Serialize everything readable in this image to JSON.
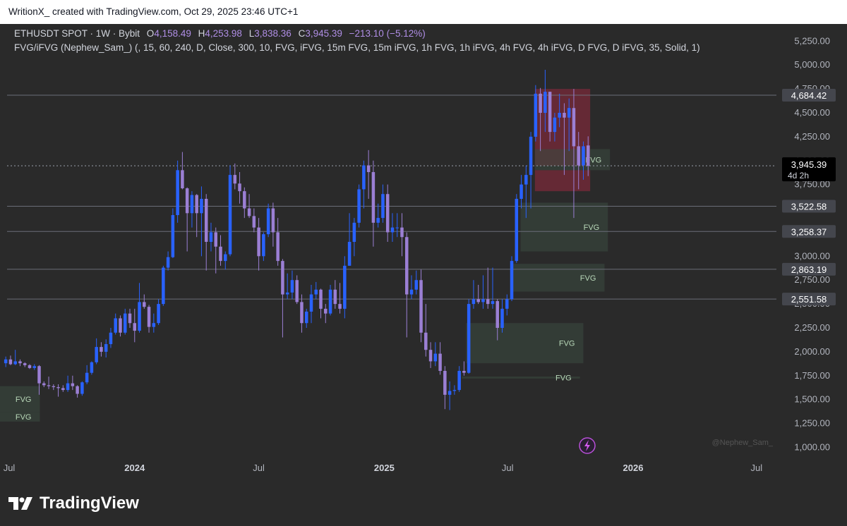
{
  "header": {
    "attribution": "WritionX_ created with TradingView.com, Oct 29, 2025 23:46 UTC+1"
  },
  "legend": {
    "symbol": "ETHUSDT SPOT · 1W · Bybit",
    "o_label": "O",
    "o_value": "4,158.49",
    "h_label": "H",
    "h_value": "4,253.98",
    "l_label": "L",
    "l_value": "3,838.36",
    "c_label": "C",
    "c_value": "3,945.39",
    "change": "−213.10 (−5.12%)",
    "indicator": "FVG/iFVG (Nephew_Sam_) (, 15, 60, 240, D, Close, 300, 10, FVG, iFVG, 15m FVG, 15m iFVG, 1h FVG, 1h iFVG, 4h FVG, 4h iFVG, D FVG, D iFVG, 35, Solid, 1)"
  },
  "footer": {
    "brand": "TradingView",
    "watermark": "@Nephew_Sam_"
  },
  "colors": {
    "up": "#2962ff",
    "down": "#9b7fd4",
    "fvg": "#3a4a3f",
    "ifvg": "#7a2a3a",
    "background": "#2a2a2a"
  },
  "chart_data": {
    "type": "candlestick",
    "symbol": "ETHUSDT",
    "timeframe": "1W",
    "ylim": [
      900,
      5400
    ],
    "y_ticks": [
      "5,250.00",
      "5,000.00",
      "4,750.00",
      "4,500.00",
      "4,250.00",
      "4,000.00",
      "3,750.00",
      "3,500.00",
      "3,250.00",
      "3,000.00",
      "2,750.00",
      "2,500.00",
      "2,250.00",
      "2,000.00",
      "1,750.00",
      "1,500.00",
      "1,250.00",
      "1,000.00"
    ],
    "x_ticks": [
      "Jul",
      "2024",
      "Jul",
      "2025",
      "Jul",
      "2026",
      "Jul"
    ],
    "price_labels": [
      {
        "value": 4684.42,
        "text": "4,684.42"
      },
      {
        "value": 3522.58,
        "text": "3,522.58"
      },
      {
        "value": 3258.37,
        "text": "3,258.37"
      },
      {
        "value": 2863.19,
        "text": "2,863.19"
      },
      {
        "value": 2551.58,
        "text": "2,551.58"
      }
    ],
    "last_price": {
      "value": 3945.39,
      "text": "3,945.39",
      "countdown": "4d 2h"
    },
    "zones": [
      {
        "kind": "iFVG",
        "label": "",
        "from": 3945,
        "to": 4750,
        "start": "2025-08-10",
        "end": "2025-10-30"
      },
      {
        "kind": "iFVG",
        "label": "",
        "from": 3680,
        "to": 3900,
        "start": "2025-08-10",
        "end": "2025-10-30"
      },
      {
        "kind": "FVG",
        "label": "FVG",
        "from": 3900,
        "to": 4120,
        "start": "2025-08-10",
        "end": "2025-11-28"
      },
      {
        "kind": "FVG",
        "label": "FVG",
        "from": 3050,
        "to": 3560,
        "start": "2025-07-20",
        "end": "2025-11-25"
      },
      {
        "kind": "FVG",
        "label": "FVG",
        "from": 2630,
        "to": 2920,
        "start": "2025-07-05",
        "end": "2025-11-20"
      },
      {
        "kind": "FVG",
        "label": "FVG",
        "from": 1880,
        "to": 2300,
        "start": "2025-05-01",
        "end": "2025-10-20"
      },
      {
        "kind": "FVG",
        "label": "FVG",
        "from": 1720,
        "to": 1740,
        "start": "2025-04-25",
        "end": "2025-10-15"
      },
      {
        "kind": "FVG",
        "label": "FVG",
        "from": 1370,
        "to": 1640,
        "start": "2023-06-10",
        "end": "2023-08-15"
      },
      {
        "kind": "FVG",
        "label": "FVG",
        "from": 1270,
        "to": 1370,
        "start": "2023-06-10",
        "end": "2023-08-15"
      }
    ],
    "candles": [
      {
        "t": "2023-06-26",
        "o": 1880,
        "h": 1950,
        "l": 1840,
        "c": 1920
      },
      {
        "t": "2023-07-03",
        "o": 1920,
        "h": 1960,
        "l": 1860,
        "c": 1870
      },
      {
        "t": "2023-07-10",
        "o": 1870,
        "h": 2020,
        "l": 1860,
        "c": 1900
      },
      {
        "t": "2023-07-17",
        "o": 1900,
        "h": 1920,
        "l": 1850,
        "c": 1880
      },
      {
        "t": "2023-07-24",
        "o": 1880,
        "h": 1890,
        "l": 1840,
        "c": 1860
      },
      {
        "t": "2023-07-31",
        "o": 1860,
        "h": 1870,
        "l": 1820,
        "c": 1830
      },
      {
        "t": "2023-08-07",
        "o": 1830,
        "h": 1870,
        "l": 1810,
        "c": 1850
      },
      {
        "t": "2023-08-14",
        "o": 1850,
        "h": 1860,
        "l": 1550,
        "c": 1670
      },
      {
        "t": "2023-08-21",
        "o": 1670,
        "h": 1690,
        "l": 1630,
        "c": 1650
      },
      {
        "t": "2023-08-28",
        "o": 1650,
        "h": 1740,
        "l": 1610,
        "c": 1640
      },
      {
        "t": "2023-09-04",
        "o": 1640,
        "h": 1660,
        "l": 1600,
        "c": 1630
      },
      {
        "t": "2023-09-11",
        "o": 1630,
        "h": 1660,
        "l": 1530,
        "c": 1620
      },
      {
        "t": "2023-09-18",
        "o": 1620,
        "h": 1650,
        "l": 1580,
        "c": 1600
      },
      {
        "t": "2023-09-25",
        "o": 1600,
        "h": 1750,
        "l": 1580,
        "c": 1670
      },
      {
        "t": "2023-10-02",
        "o": 1670,
        "h": 1750,
        "l": 1600,
        "c": 1640
      },
      {
        "t": "2023-10-09",
        "o": 1640,
        "h": 1650,
        "l": 1520,
        "c": 1560
      },
      {
        "t": "2023-10-16",
        "o": 1560,
        "h": 1690,
        "l": 1540,
        "c": 1680
      },
      {
        "t": "2023-10-23",
        "o": 1680,
        "h": 1860,
        "l": 1660,
        "c": 1780
      },
      {
        "t": "2023-10-30",
        "o": 1780,
        "h": 1900,
        "l": 1760,
        "c": 1890
      },
      {
        "t": "2023-11-06",
        "o": 1890,
        "h": 2140,
        "l": 1870,
        "c": 2050
      },
      {
        "t": "2023-11-13",
        "o": 2050,
        "h": 2100,
        "l": 1950,
        "c": 2000
      },
      {
        "t": "2023-11-20",
        "o": 2000,
        "h": 2130,
        "l": 1940,
        "c": 2080
      },
      {
        "t": "2023-11-27",
        "o": 2080,
        "h": 2250,
        "l": 2040,
        "c": 2200
      },
      {
        "t": "2023-12-04",
        "o": 2200,
        "h": 2400,
        "l": 2180,
        "c": 2350
      },
      {
        "t": "2023-12-11",
        "o": 2350,
        "h": 2380,
        "l": 2160,
        "c": 2200
      },
      {
        "t": "2023-12-18",
        "o": 2200,
        "h": 2450,
        "l": 2180,
        "c": 2400
      },
      {
        "t": "2023-12-25",
        "o": 2400,
        "h": 2450,
        "l": 2250,
        "c": 2300
      },
      {
        "t": "2024-01-01",
        "o": 2300,
        "h": 2450,
        "l": 2100,
        "c": 2220
      },
      {
        "t": "2024-01-08",
        "o": 2220,
        "h": 2720,
        "l": 2200,
        "c": 2520
      },
      {
        "t": "2024-01-15",
        "o": 2520,
        "h": 2600,
        "l": 2450,
        "c": 2470
      },
      {
        "t": "2024-01-22",
        "o": 2470,
        "h": 2490,
        "l": 2200,
        "c": 2260
      },
      {
        "t": "2024-01-29",
        "o": 2260,
        "h": 2400,
        "l": 2200,
        "c": 2300
      },
      {
        "t": "2024-02-05",
        "o": 2300,
        "h": 2550,
        "l": 2280,
        "c": 2500
      },
      {
        "t": "2024-02-12",
        "o": 2500,
        "h": 2900,
        "l": 2480,
        "c": 2880
      },
      {
        "t": "2024-02-19",
        "o": 2880,
        "h": 3050,
        "l": 2850,
        "c": 2990
      },
      {
        "t": "2024-02-26",
        "o": 2990,
        "h": 3500,
        "l": 2980,
        "c": 3430
      },
      {
        "t": "2024-03-04",
        "o": 3430,
        "h": 4000,
        "l": 3350,
        "c": 3900
      },
      {
        "t": "2024-03-11",
        "o": 3900,
        "h": 4090,
        "l": 3700,
        "c": 3710
      },
      {
        "t": "2024-03-18",
        "o": 3710,
        "h": 3720,
        "l": 3050,
        "c": 3450
      },
      {
        "t": "2024-03-25",
        "o": 3450,
        "h": 3680,
        "l": 3300,
        "c": 3640
      },
      {
        "t": "2024-04-01",
        "o": 3640,
        "h": 3650,
        "l": 3200,
        "c": 3450
      },
      {
        "t": "2024-04-08",
        "o": 3450,
        "h": 3730,
        "l": 3000,
        "c": 3600
      },
      {
        "t": "2024-04-15",
        "o": 3600,
        "h": 3650,
        "l": 2850,
        "c": 3150
      },
      {
        "t": "2024-04-22",
        "o": 3150,
        "h": 3350,
        "l": 3050,
        "c": 3250
      },
      {
        "t": "2024-04-29",
        "o": 3250,
        "h": 3300,
        "l": 2820,
        "c": 3100
      },
      {
        "t": "2024-05-06",
        "o": 3100,
        "h": 3220,
        "l": 2900,
        "c": 2950
      },
      {
        "t": "2024-05-13",
        "o": 2950,
        "h": 3050,
        "l": 2860,
        "c": 3020
      },
      {
        "t": "2024-05-20",
        "o": 3020,
        "h": 3950,
        "l": 3000,
        "c": 3850
      },
      {
        "t": "2024-05-27",
        "o": 3850,
        "h": 3970,
        "l": 3700,
        "c": 3760
      },
      {
        "t": "2024-06-03",
        "o": 3760,
        "h": 3880,
        "l": 3550,
        "c": 3680
      },
      {
        "t": "2024-06-10",
        "o": 3680,
        "h": 3720,
        "l": 3400,
        "c": 3500
      },
      {
        "t": "2024-06-17",
        "o": 3500,
        "h": 3650,
        "l": 3400,
        "c": 3420
      },
      {
        "t": "2024-06-24",
        "o": 3420,
        "h": 3500,
        "l": 3250,
        "c": 3300
      },
      {
        "t": "2024-07-01",
        "o": 3300,
        "h": 3400,
        "l": 2850,
        "c": 3000
      },
      {
        "t": "2024-07-08",
        "o": 3000,
        "h": 3250,
        "l": 2950,
        "c": 3230
      },
      {
        "t": "2024-07-15",
        "o": 3230,
        "h": 3550,
        "l": 3200,
        "c": 3500
      },
      {
        "t": "2024-07-22",
        "o": 3500,
        "h": 3560,
        "l": 3100,
        "c": 3250
      },
      {
        "t": "2024-07-29",
        "o": 3250,
        "h": 3400,
        "l": 2900,
        "c": 2950
      },
      {
        "t": "2024-08-05",
        "o": 2950,
        "h": 2970,
        "l": 2150,
        "c": 2600
      },
      {
        "t": "2024-08-12",
        "o": 2600,
        "h": 2820,
        "l": 2550,
        "c": 2620
      },
      {
        "t": "2024-08-19",
        "o": 2620,
        "h": 2850,
        "l": 2550,
        "c": 2750
      },
      {
        "t": "2024-08-26",
        "o": 2750,
        "h": 2800,
        "l": 2500,
        "c": 2520
      },
      {
        "t": "2024-09-02",
        "o": 2520,
        "h": 2600,
        "l": 2200,
        "c": 2300
      },
      {
        "t": "2024-09-09",
        "o": 2300,
        "h": 2450,
        "l": 2250,
        "c": 2420
      },
      {
        "t": "2024-09-16",
        "o": 2420,
        "h": 2700,
        "l": 2300,
        "c": 2600
      },
      {
        "t": "2024-09-23",
        "o": 2600,
        "h": 2730,
        "l": 2550,
        "c": 2650
      },
      {
        "t": "2024-09-30",
        "o": 2650,
        "h": 2660,
        "l": 2350,
        "c": 2450
      },
      {
        "t": "2024-10-07",
        "o": 2450,
        "h": 2500,
        "l": 2300,
        "c": 2400
      },
      {
        "t": "2024-10-14",
        "o": 2400,
        "h": 2700,
        "l": 2380,
        "c": 2650
      },
      {
        "t": "2024-10-21",
        "o": 2650,
        "h": 2750,
        "l": 2450,
        "c": 2500
      },
      {
        "t": "2024-10-28",
        "o": 2500,
        "h": 2720,
        "l": 2400,
        "c": 2450
      },
      {
        "t": "2024-11-04",
        "o": 2450,
        "h": 3000,
        "l": 2350,
        "c": 2900
      },
      {
        "t": "2024-11-11",
        "o": 2900,
        "h": 3450,
        "l": 2900,
        "c": 3150
      },
      {
        "t": "2024-11-18",
        "o": 3150,
        "h": 3400,
        "l": 3000,
        "c": 3350
      },
      {
        "t": "2024-11-25",
        "o": 3350,
        "h": 3750,
        "l": 3300,
        "c": 3700
      },
      {
        "t": "2024-12-02",
        "o": 3700,
        "h": 4000,
        "l": 3500,
        "c": 3950
      },
      {
        "t": "2024-12-09",
        "o": 3950,
        "h": 4110,
        "l": 3600,
        "c": 3880
      },
      {
        "t": "2024-12-16",
        "o": 3880,
        "h": 4000,
        "l": 3100,
        "c": 3350
      },
      {
        "t": "2024-12-23",
        "o": 3350,
        "h": 3550,
        "l": 3300,
        "c": 3400
      },
      {
        "t": "2024-12-30",
        "o": 3400,
        "h": 3750,
        "l": 3350,
        "c": 3650
      },
      {
        "t": "2025-01-06",
        "o": 3650,
        "h": 3750,
        "l": 3150,
        "c": 3250
      },
      {
        "t": "2025-01-13",
        "o": 3250,
        "h": 3450,
        "l": 3150,
        "c": 3300
      },
      {
        "t": "2025-01-20",
        "o": 3300,
        "h": 3450,
        "l": 3200,
        "c": 3300
      },
      {
        "t": "2025-01-27",
        "o": 3300,
        "h": 3450,
        "l": 3000,
        "c": 3200
      },
      {
        "t": "2025-02-03",
        "o": 3200,
        "h": 3250,
        "l": 2150,
        "c": 2600
      },
      {
        "t": "2025-02-10",
        "o": 2600,
        "h": 2800,
        "l": 2550,
        "c": 2650
      },
      {
        "t": "2025-02-17",
        "o": 2650,
        "h": 2850,
        "l": 2600,
        "c": 2750
      },
      {
        "t": "2025-02-24",
        "o": 2750,
        "h": 2860,
        "l": 2100,
        "c": 2200
      },
      {
        "t": "2025-03-03",
        "o": 2200,
        "h": 2500,
        "l": 1950,
        "c": 2020
      },
      {
        "t": "2025-03-10",
        "o": 2020,
        "h": 2100,
        "l": 1830,
        "c": 1900
      },
      {
        "t": "2025-03-17",
        "o": 1900,
        "h": 2100,
        "l": 1850,
        "c": 1980
      },
      {
        "t": "2025-03-24",
        "o": 1980,
        "h": 2100,
        "l": 1760,
        "c": 1800
      },
      {
        "t": "2025-03-31",
        "o": 1800,
        "h": 1850,
        "l": 1400,
        "c": 1550
      },
      {
        "t": "2025-04-07",
        "o": 1550,
        "h": 1690,
        "l": 1390,
        "c": 1590
      },
      {
        "t": "2025-04-14",
        "o": 1590,
        "h": 1650,
        "l": 1550,
        "c": 1600
      },
      {
        "t": "2025-04-21",
        "o": 1600,
        "h": 1850,
        "l": 1580,
        "c": 1800
      },
      {
        "t": "2025-04-28",
        "o": 1800,
        "h": 1900,
        "l": 1750,
        "c": 1780
      },
      {
        "t": "2025-05-05",
        "o": 1780,
        "h": 2550,
        "l": 1770,
        "c": 2500
      },
      {
        "t": "2025-05-12",
        "o": 2500,
        "h": 2750,
        "l": 2450,
        "c": 2550
      },
      {
        "t": "2025-05-19",
        "o": 2550,
        "h": 2700,
        "l": 2500,
        "c": 2520
      },
      {
        "t": "2025-05-26",
        "o": 2520,
        "h": 2800,
        "l": 2450,
        "c": 2550
      },
      {
        "t": "2025-06-02",
        "o": 2550,
        "h": 2880,
        "l": 2450,
        "c": 2500
      },
      {
        "t": "2025-06-09",
        "o": 2500,
        "h": 2880,
        "l": 2450,
        "c": 2530
      },
      {
        "t": "2025-06-16",
        "o": 2530,
        "h": 2550,
        "l": 2120,
        "c": 2250
      },
      {
        "t": "2025-06-23",
        "o": 2250,
        "h": 2550,
        "l": 2200,
        "c": 2450
      },
      {
        "t": "2025-06-30",
        "o": 2450,
        "h": 2600,
        "l": 2380,
        "c": 2550
      },
      {
        "t": "2025-07-07",
        "o": 2550,
        "h": 3000,
        "l": 2530,
        "c": 2950
      },
      {
        "t": "2025-07-14",
        "o": 2950,
        "h": 3650,
        "l": 2930,
        "c": 3600
      },
      {
        "t": "2025-07-21",
        "o": 3600,
        "h": 3850,
        "l": 3500,
        "c": 3750
      },
      {
        "t": "2025-07-28",
        "o": 3750,
        "h": 3950,
        "l": 3400,
        "c": 3850
      },
      {
        "t": "2025-08-04",
        "o": 3850,
        "h": 4300,
        "l": 3500,
        "c": 4250
      },
      {
        "t": "2025-08-11",
        "o": 4250,
        "h": 4790,
        "l": 4200,
        "c": 4700
      },
      {
        "t": "2025-08-18",
        "o": 4700,
        "h": 4760,
        "l": 4100,
        "c": 4500
      },
      {
        "t": "2025-08-25",
        "o": 4500,
        "h": 4950,
        "l": 4300,
        "c": 4720
      },
      {
        "t": "2025-09-01",
        "o": 4720,
        "h": 4720,
        "l": 4200,
        "c": 4300
      },
      {
        "t": "2025-09-08",
        "o": 4300,
        "h": 4500,
        "l": 4200,
        "c": 4450
      },
      {
        "t": "2025-09-15",
        "o": 4450,
        "h": 4700,
        "l": 4350,
        "c": 4500
      },
      {
        "t": "2025-09-22",
        "o": 4500,
        "h": 4600,
        "l": 3850,
        "c": 4450
      },
      {
        "t": "2025-09-29",
        "o": 4450,
        "h": 4650,
        "l": 4100,
        "c": 4550
      },
      {
        "t": "2025-10-06",
        "o": 4550,
        "h": 4750,
        "l": 3400,
        "c": 4150
      },
      {
        "t": "2025-10-13",
        "o": 4150,
        "h": 4300,
        "l": 3700,
        "c": 3950
      },
      {
        "t": "2025-10-20",
        "o": 3950,
        "h": 4200,
        "l": 3800,
        "c": 4150
      },
      {
        "t": "2025-10-27",
        "o": 4158.49,
        "h": 4253.98,
        "l": 3838.36,
        "c": 3945.39
      }
    ]
  }
}
